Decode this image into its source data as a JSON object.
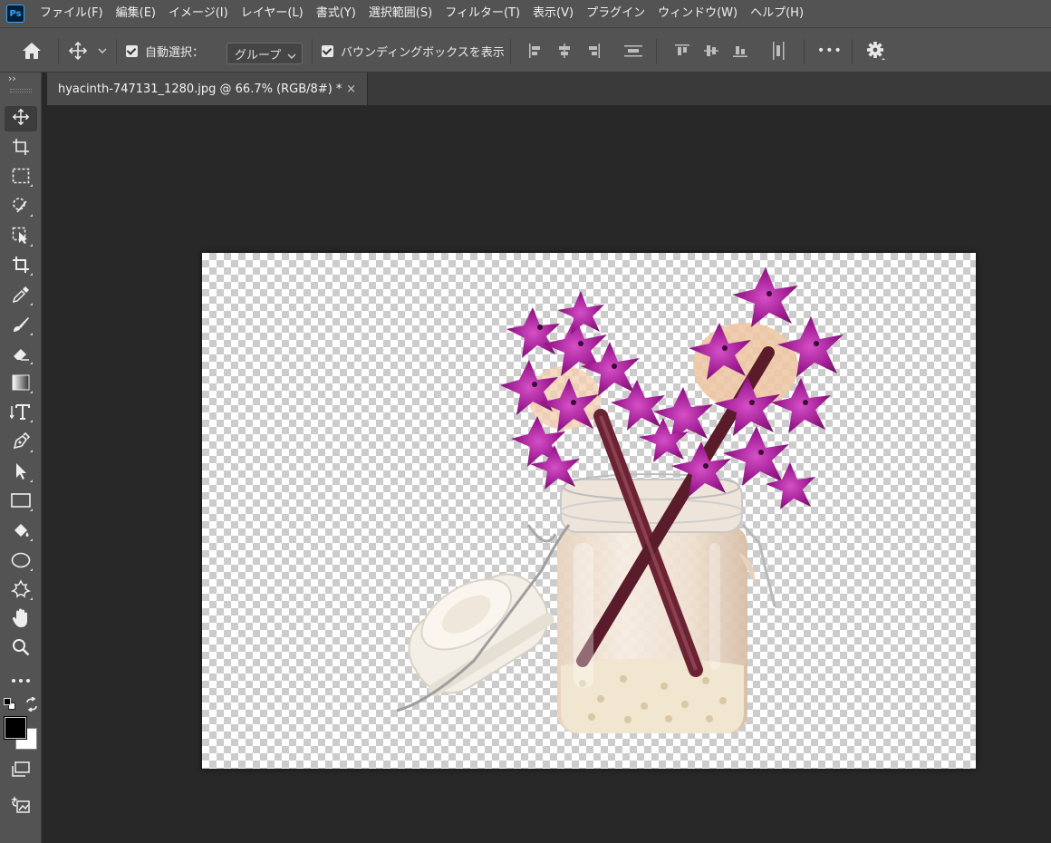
{
  "app": {
    "logo_text": "Ps"
  },
  "menu": [
    "ファイル(F)",
    "編集(E)",
    "イメージ(I)",
    "レイヤー(L)",
    "書式(Y)",
    "選択範囲(S)",
    "フィルター(T)",
    "表示(V)",
    "プラグイン",
    "ウィンドウ(W)",
    "ヘルプ(H)"
  ],
  "options": {
    "auto_select_label": "自動選択：",
    "auto_select_value": "グループ",
    "bounding_box_label": "バウンディングボックスを表示",
    "more_label": "•••"
  },
  "document": {
    "tab_title": "hyacinth-747131_1280.jpg @ 66.7% (RGB/8#) *",
    "close_glyph": "×"
  },
  "colors": {
    "foreground": "#000000",
    "background": "#ffffff",
    "ui_panel": "#535353",
    "workspace": "#282828",
    "flower": "#9a1d8c"
  },
  "toolbar": {
    "collapse_glyph": "››",
    "tools": [
      "move-icon",
      "artboard-icon",
      "marquee-icon",
      "quick-select-icon",
      "object-select-icon",
      "crop-icon",
      "eyedropper-icon",
      "brush-icon",
      "eraser-icon",
      "gradient-icon",
      "type-icon",
      "pen-icon",
      "path-select-icon",
      "rectangle-icon",
      "paint-bucket-icon",
      "ellipse-icon",
      "custom-shape-icon",
      "hand-icon",
      "zoom-icon",
      "more-tools-icon"
    ]
  }
}
